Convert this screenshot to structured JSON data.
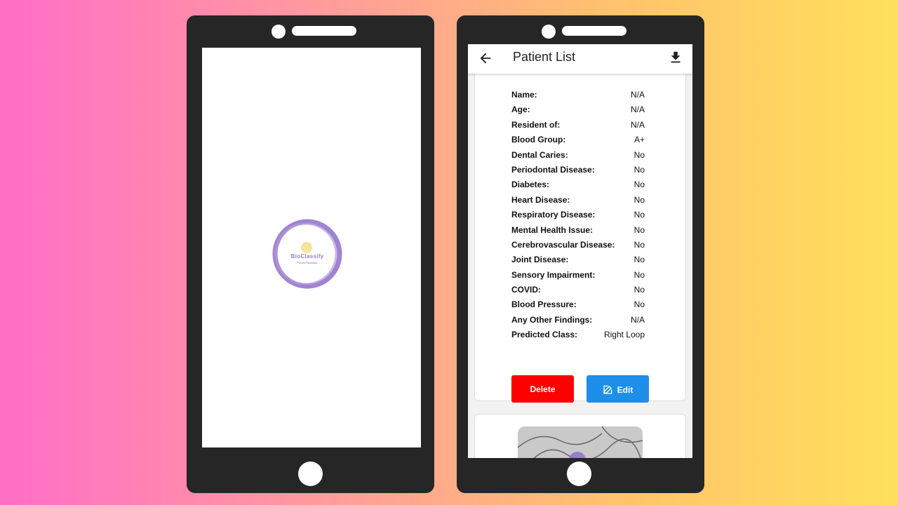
{
  "splash": {
    "logo_text": "BioClassify",
    "logo_subtext": "Pouch Repeater"
  },
  "patient_list": {
    "title": "Patient List",
    "fields": [
      {
        "label": "Name:",
        "value": "N/A"
      },
      {
        "label": "Age:",
        "value": "N/A"
      },
      {
        "label": "Resident of:",
        "value": "N/A"
      },
      {
        "label": "Blood Group:",
        "value": "A+"
      },
      {
        "label": "Dental Caries:",
        "value": "No"
      },
      {
        "label": "Periodontal Disease:",
        "value": "No"
      },
      {
        "label": "Diabetes:",
        "value": "No"
      },
      {
        "label": "Heart Disease:",
        "value": "No"
      },
      {
        "label": "Respiratory Disease:",
        "value": "No"
      },
      {
        "label": "Mental Health Issue:",
        "value": "No"
      },
      {
        "label": "Cerebrovascular Disease:",
        "value": "No"
      },
      {
        "label": "Joint Disease:",
        "value": "No"
      },
      {
        "label": "Sensory Impairment:",
        "value": "No"
      },
      {
        "label": "COVID:",
        "value": "No"
      },
      {
        "label": "Blood Pressure:",
        "value": "No"
      },
      {
        "label": "Any Other Findings:",
        "value": "N/A"
      },
      {
        "label": "Predicted Class:",
        "value": "Right Loop"
      }
    ],
    "delete_label": "Delete",
    "edit_label": "Edit"
  },
  "colors": {
    "delete": "#ff0000",
    "edit": "#1e8fe8",
    "logo": "#9b7ccf"
  },
  "icons": {
    "back": "arrow-left-icon",
    "download": "download-icon",
    "edit": "edit-icon"
  }
}
